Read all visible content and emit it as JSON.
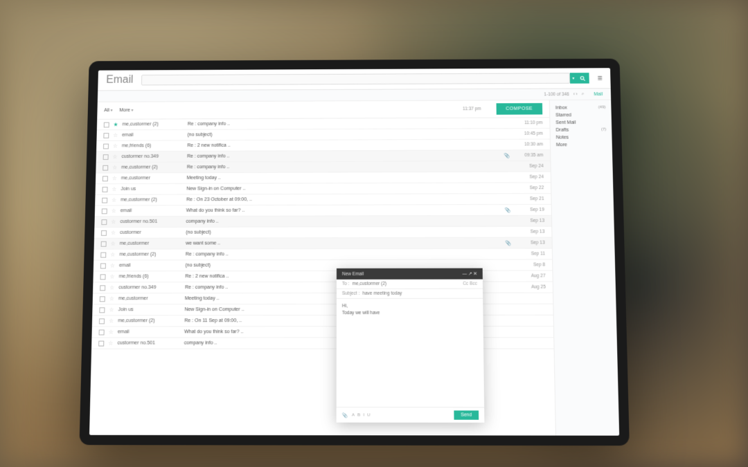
{
  "app": {
    "title": "Email"
  },
  "search": {
    "placeholder": ""
  },
  "topright": {
    "mail": "Mail"
  },
  "pagination": {
    "range": "1-100 of 346",
    "nav": "‹ ›",
    "search_icon": "⌕"
  },
  "filter": {
    "all": "All",
    "more": "More",
    "time": "11:37 pm",
    "compose": "COMPOSE"
  },
  "sidebar": {
    "items": [
      {
        "label": "Inbox",
        "count": "(49)"
      },
      {
        "label": "Starred",
        "count": ""
      },
      {
        "label": "Sent Mail",
        "count": ""
      },
      {
        "label": "Drafts",
        "count": "(7)"
      },
      {
        "label": "Notes",
        "count": ""
      },
      {
        "label": "More",
        "count": ""
      }
    ]
  },
  "emails": [
    {
      "starred": true,
      "sender": "me,custormer (2)",
      "subject": "Re : company info ..",
      "attach": false,
      "date": "11:10 pm",
      "shaded": false
    },
    {
      "starred": false,
      "sender": "email",
      "subject": "(no subject)",
      "attach": false,
      "date": "10:45 pm",
      "shaded": false
    },
    {
      "starred": false,
      "sender": "me,friends (6)",
      "subject": "Re : 2 new notifica ..",
      "attach": false,
      "date": "10:30 am",
      "shaded": false
    },
    {
      "starred": false,
      "sender": "custormer no.349",
      "subject": "Re : company info ..",
      "attach": true,
      "date": "09:35 am",
      "shaded": true
    },
    {
      "starred": false,
      "sender": "me,custormer (2)",
      "subject": "Re : company info ..",
      "attach": false,
      "date": "Sep 24",
      "shaded": true
    },
    {
      "starred": false,
      "sender": "me,custormer",
      "subject": "Meeting today ..",
      "attach": false,
      "date": "Sep 24",
      "shaded": false
    },
    {
      "starred": false,
      "sender": "Join us",
      "subject": "New Sign-in on Computer ..",
      "attach": false,
      "date": "Sep 22",
      "shaded": false
    },
    {
      "starred": false,
      "sender": "me,custormer (2)",
      "subject": "Re : On 23 October at 09:00, ..",
      "attach": false,
      "date": "Sep 21",
      "shaded": false
    },
    {
      "starred": false,
      "sender": "email",
      "subject": "What do you think so far? ..",
      "attach": true,
      "date": "Sep 19",
      "shaded": false
    },
    {
      "starred": false,
      "sender": "custormer no.501",
      "subject": "company info ..",
      "attach": false,
      "date": "Sep 13",
      "shaded": true
    },
    {
      "starred": false,
      "sender": "custormer",
      "subject": "(no subject)",
      "attach": false,
      "date": "Sep 13",
      "shaded": false
    },
    {
      "starred": false,
      "sender": "me,custormer",
      "subject": "we want some ..",
      "attach": true,
      "date": "Sep 13",
      "shaded": true
    },
    {
      "starred": false,
      "sender": "me,custormer (2)",
      "subject": "Re : company info ..",
      "attach": false,
      "date": "Sep 11",
      "shaded": false
    },
    {
      "starred": false,
      "sender": "email",
      "subject": "(no subject)",
      "attach": false,
      "date": "Sep 8",
      "shaded": false
    },
    {
      "starred": false,
      "sender": "me,friends (6)",
      "subject": "Re : 2 new notifica ..",
      "attach": false,
      "date": "Aug 27",
      "shaded": false
    },
    {
      "starred": false,
      "sender": "custormer no.349",
      "subject": "Re : company info ..",
      "attach": false,
      "date": "Aug 25",
      "shaded": false
    },
    {
      "starred": false,
      "sender": "me,custormer",
      "subject": "Meeting today ..",
      "attach": false,
      "date": "",
      "shaded": false
    },
    {
      "starred": false,
      "sender": "Join us",
      "subject": "New Sign-in on Computer ..",
      "attach": false,
      "date": "",
      "shaded": false
    },
    {
      "starred": false,
      "sender": "me,custormer (2)",
      "subject": "Re : On 11 Sep at 09:00, ..",
      "attach": false,
      "date": "",
      "shaded": false
    },
    {
      "starred": false,
      "sender": "email",
      "subject": "What do you think so far? ..",
      "attach": false,
      "date": "",
      "shaded": false
    },
    {
      "starred": false,
      "sender": "custormer no.501",
      "subject": "company info ..",
      "attach": false,
      "date": "",
      "shaded": false
    }
  ],
  "compose": {
    "title": "New Email",
    "min": "— ↗ ✕",
    "to_label": "To :",
    "to_value": "me,custormer (2)",
    "ccbcc": "Cc  Bcc",
    "subject_label": "Subject :",
    "subject_value": "have meeting today",
    "body_line1": "Hi,",
    "body_line2": "Today we will have",
    "attach_icon": "📎",
    "send": "Send"
  }
}
